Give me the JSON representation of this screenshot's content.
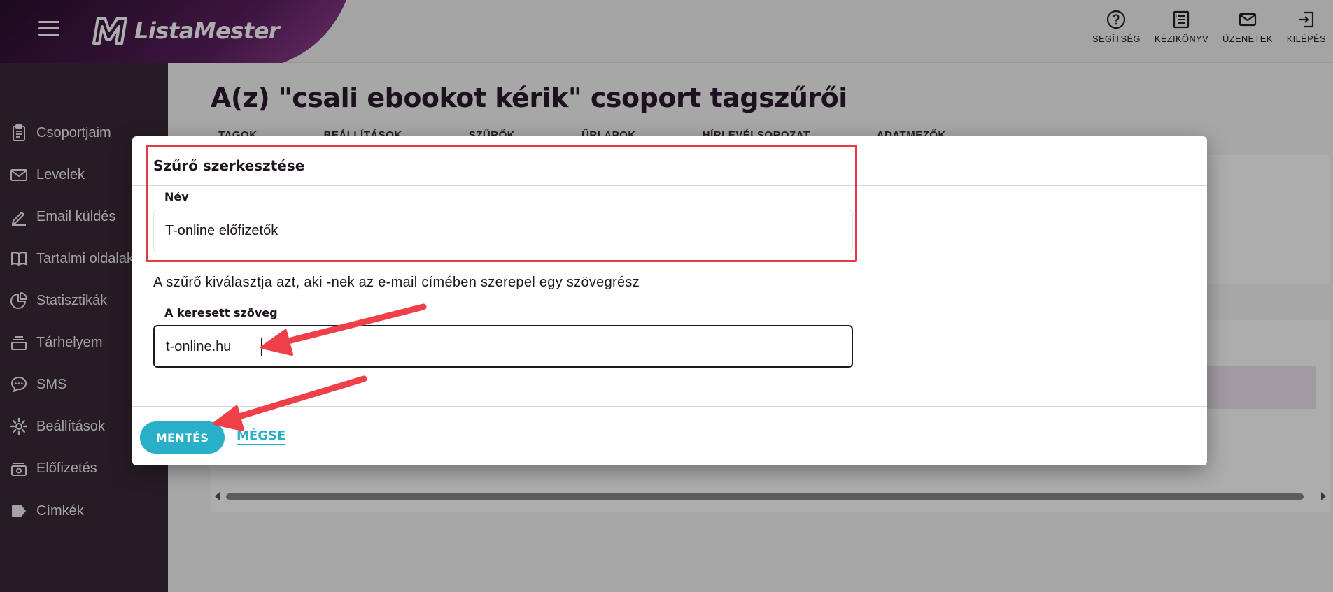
{
  "app": {
    "name": "ListaMester"
  },
  "topbar": {
    "actions": [
      {
        "label": "SEGÍTSÉG",
        "icon": "help-circle-icon"
      },
      {
        "label": "KÉZIKÖNYV",
        "icon": "manual-icon"
      },
      {
        "label": "ÜZENETEK",
        "icon": "mail-icon"
      },
      {
        "label": "KILÉPÉS",
        "icon": "logout-icon"
      }
    ]
  },
  "sidebar": {
    "items": [
      {
        "label": "Csoportjaim",
        "icon": "clipboard-icon"
      },
      {
        "label": "Levelek",
        "icon": "envelope-icon"
      },
      {
        "label": "Email küldés",
        "icon": "pencil-icon"
      },
      {
        "label": "Tartalmi oldalak",
        "icon": "book-icon"
      },
      {
        "label": "Statisztikák",
        "icon": "pie-chart-icon"
      },
      {
        "label": "Tárhelyem",
        "icon": "storage-icon"
      },
      {
        "label": "SMS",
        "icon": "chat-icon"
      },
      {
        "label": "Beállítások",
        "icon": "gear-icon"
      },
      {
        "label": "Előfizetés",
        "icon": "subscription-icon"
      },
      {
        "label": "Címkék",
        "icon": "tag-icon"
      }
    ]
  },
  "page": {
    "title": "A(z) \"csali ebookot kérik\" csoport tagszűrői",
    "tabs": [
      "TAGOK",
      "BEÁLLÍTÁSOK",
      "SZŰRŐK",
      "ŰRLAPOK",
      "HÍRLEVÉLSOROZAT",
      "ADATMEZŐK"
    ]
  },
  "dialog": {
    "title": "Szűrő szerkesztése",
    "name_label": "Név",
    "name_value": "T-online előfizetők",
    "description": "A szűrő kiválasztja azt, aki -nek az e-mail címében szerepel egy szövegrész",
    "search_label": "A keresett szöveg",
    "search_value": "t-online.hu",
    "save_label": "MENTÉS",
    "cancel_label": "MÉGSE"
  },
  "colors": {
    "accent": "#2aafc8",
    "sidebar_bg": "#3a2a38",
    "annotation": "#e53945",
    "brand_purple": "#5a1f5e"
  }
}
